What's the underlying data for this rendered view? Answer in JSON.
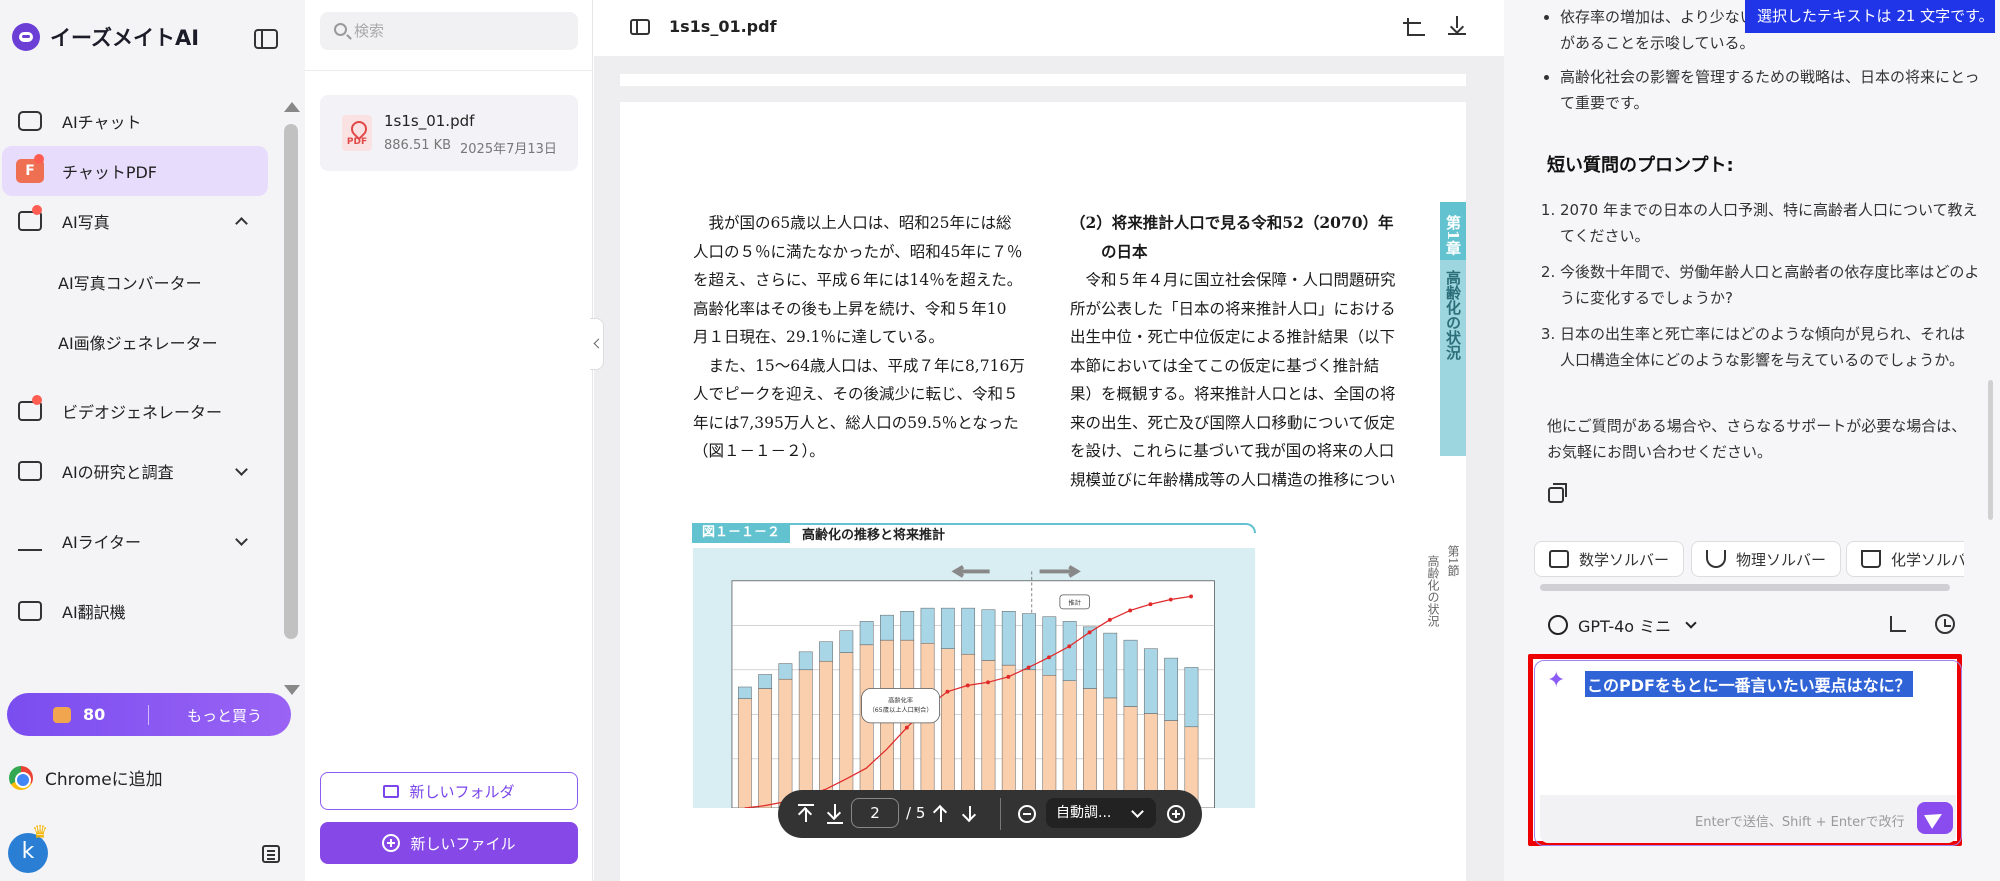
{
  "app": {
    "brand": "イーズメイトAI"
  },
  "sidebar": {
    "items": [
      {
        "label": "AIチャット",
        "icon": "chat-icon"
      },
      {
        "label": "チャットPDF",
        "icon": "pdf-icon"
      },
      {
        "label": "AI写真",
        "icon": "photo-icon"
      },
      {
        "label": "AI写真コンバーター"
      },
      {
        "label": "AI画像ジェネレーター"
      },
      {
        "label": "ビデオジェネレーター",
        "icon": "video-icon"
      },
      {
        "label": "AIの研究と調査",
        "icon": "research-icon"
      },
      {
        "label": "AIライター",
        "icon": "writer-icon"
      },
      {
        "label": "AI翻訳機",
        "icon": "translate-icon"
      }
    ],
    "credits": "80",
    "buy_more": "もっと買う",
    "chrome_add": "Chromeに追加",
    "avatar_letter": "k"
  },
  "files": {
    "search_placeholder": "検索",
    "file": {
      "name": "1s1s_01.pdf",
      "size": "886.51 KB",
      "date": "2025年7月13日"
    },
    "new_folder": "新しいフォルダ",
    "new_file": "新しいファイル"
  },
  "viewer": {
    "title": "1s1s_01.pdf",
    "col1": "　我が国の65歳以上人口は、昭和25年には総\n人口の５％に満たなかったが、昭和45年に７％\nを超え、さらに、平成６年には14％を超えた。\n高齢化率はその後も上昇を続け、令和５年10\n月１日現在、29.1％に達している。\n　また、15～64歳人口は、平成７年に8,716万\n人でピークを迎え、その後減少に転じ、令和５\n年には7,395万人と、総人口の59.5％となった\n（図１－１－２）。",
    "col2_heading": "（2）将来推計人口で見る令和52（2070）年\n　　の日本",
    "col2": "　令和５年４月に国立社会保障・人口問題研究\n所が公表した「日本の将来推計人口」における\n出生中位・死亡中位仮定による推計結果（以下\n本節においては全てこの仮定に基づく推計結\n果）を概観する。将来推計人口とは、全国の将\n来の出生、死亡及び国際人口移動について仮定\nを設け、これらに基づいて我が国の将来の人口\n規模並びに年齢構成等の人口構造の推移につい",
    "tab_chapter": "第1章",
    "tab_section": "高齢化の状況",
    "side_note1": "第1節",
    "side_note2": "高齢化の状況",
    "figure_number": "図１－１－２",
    "figure_title": "高齢化の推移と将来推計",
    "chart_callout": "高齢化率\n（65歳以上人口割合）",
    "chart_callout2": "推計",
    "page_current": "2",
    "page_total": "/ 5",
    "zoom": "自動調..."
  },
  "chat": {
    "banner": "選択したテキストは 21 文字です。",
    "bullets": [
      "依存率の増加は、より少ない労働者で高齢者人口を支える必要があることを示唆している。",
      "高齢化社会の影響を管理するための戦略は、日本の将来にとって重要です。"
    ],
    "section_title": "短い質問のプロンプト:",
    "questions": [
      "2070 年までの日本の人口予測、特に高齢者人口について教えてください。",
      "今後数十年間で、労働年齢人口と高齢者の依存度比率はどのように変化するでしょうか?",
      "日本の出生率と死亡率にはどのような傾向が見られ、それは人口構造全体にどのような影響を与えているのでしょうか。"
    ],
    "outro": "他にご質問がある場合や、さらなるサポートが必要な場合は、お気軽にお問い合わせください。",
    "tools": [
      "数学ソルバー",
      "物理ソルバー",
      "化学ソルバー"
    ],
    "model": "GPT-4o ミニ",
    "query": "このPDFをもとに一番言いたい要点はなに？",
    "hint": "Enterで送信、Shift + Enterで改行"
  }
}
